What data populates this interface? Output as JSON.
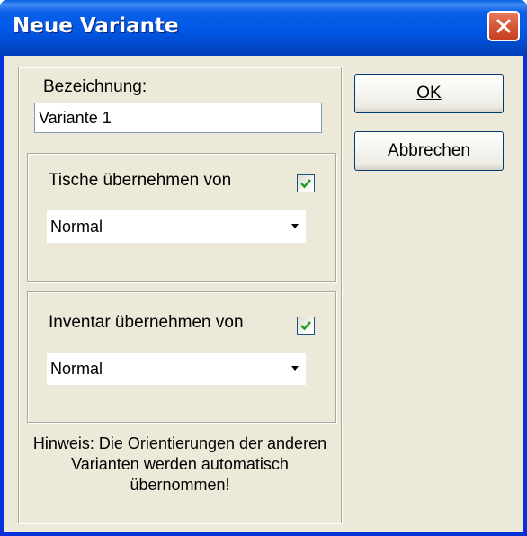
{
  "window": {
    "title": "Neue Variante"
  },
  "form": {
    "bezeichnung_label": "Bezeichnung:",
    "bezeichnung_value": "Variante 1",
    "tische": {
      "label": "Tische übernehmen von",
      "checked": true,
      "selected": "Normal"
    },
    "inventar": {
      "label": "Inventar übernehmen von",
      "checked": true,
      "selected": "Normal"
    },
    "hint": "Hinweis: Die Orientierungen der anderen Varianten werden automatisch übernommen!"
  },
  "buttons": {
    "ok": "OK",
    "cancel": "Abbrechen"
  },
  "colors": {
    "titlebar": "#0058e6",
    "dialog_bg": "#ece9d8",
    "close_button": "#d85a3a",
    "checkmark": "#21a121"
  },
  "icons": [
    "close-icon",
    "checkmark-icon",
    "dropdown-arrow-icon"
  ]
}
